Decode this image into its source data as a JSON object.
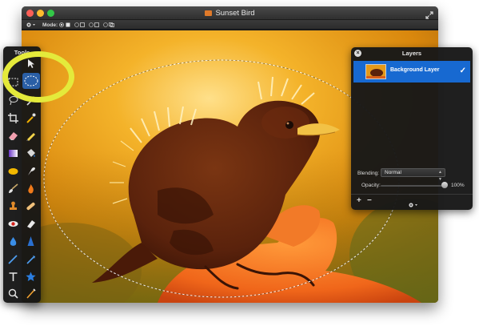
{
  "window": {
    "title": "Sunset Bird",
    "title_icon": "image-file-icon",
    "fullscreen_icon": "fullscreen-arrows-icon"
  },
  "toolbar": {
    "mode_label": "Mode:",
    "mode_options": [
      "new-selection-icon",
      "add-to-selection-icon",
      "subtract-selection-icon",
      "intersect-selection-icon"
    ]
  },
  "tools_panel": {
    "title": "Tools",
    "tools": [
      "arrow-move-icon",
      "rect-marquee-icon",
      "ellipse-marquee-icon",
      "lasso-icon",
      "magic-wand-icon",
      "crop-icon",
      "eyedropper-icon",
      "eraser-icon",
      "pencil-icon",
      "gradient-icon",
      "paint-bucket-icon",
      "sponge-icon",
      "smudge-icon",
      "brush-icon",
      "burn-icon",
      "stamp-icon",
      "bandage-icon",
      "red-eye-icon",
      "dodge-icon",
      "blur-drop-icon",
      "sharpen-icon",
      "pen-icon",
      "line-icon",
      "text-icon",
      "shape-star-icon",
      "zoom-icon",
      "hand-icon"
    ]
  },
  "layers_panel": {
    "title": "Layers",
    "layer_name": "Background Layer",
    "layer_visible_mark": "✓",
    "blending_label": "Blending:",
    "blending_value": "Normal",
    "opacity_label": "Opacity:",
    "opacity_value": "100%",
    "opacity_fraction": 1.0,
    "add_label": "+",
    "remove_label": "−"
  },
  "colors": {
    "highlight_ring": "#e4ea3b",
    "selected_layer": "#1769d1",
    "photo_warm": "#e08a0e"
  }
}
